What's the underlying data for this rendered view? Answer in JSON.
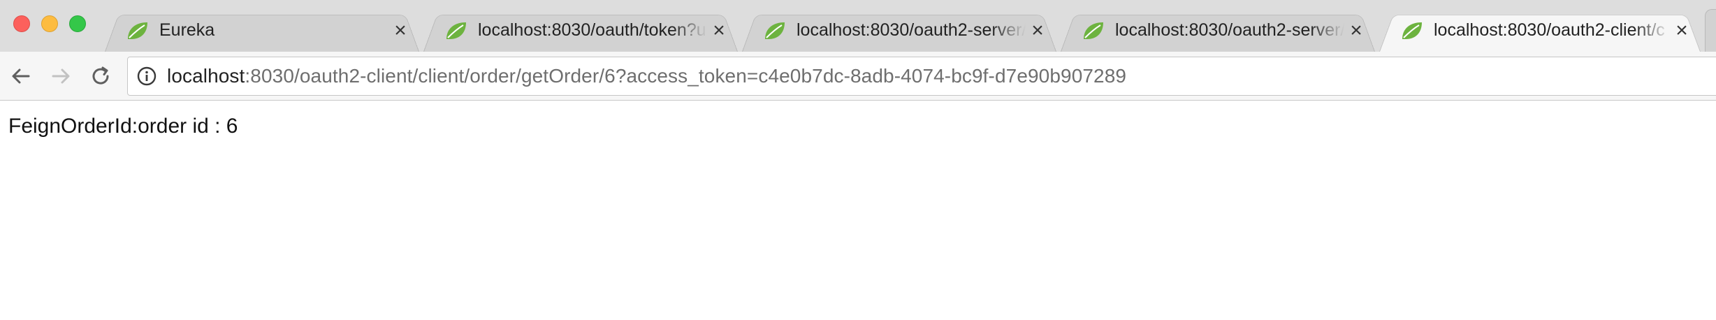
{
  "window": {
    "traffic_lights": [
      "close",
      "minimize",
      "zoom"
    ]
  },
  "tabs": [
    {
      "title": "Eureka",
      "icon": "spring-leaf-icon",
      "close": "×",
      "active": false
    },
    {
      "title": "localhost:8030/oauth/token?us",
      "icon": "spring-leaf-icon",
      "close": "×",
      "active": false
    },
    {
      "title": "localhost:8030/oauth2-server/",
      "icon": "spring-leaf-icon",
      "close": "×",
      "active": false
    },
    {
      "title": "localhost:8030/oauth2-server/",
      "icon": "spring-leaf-icon",
      "close": "×",
      "active": false
    },
    {
      "title": "localhost:8030/oauth2-client/c",
      "icon": "spring-leaf-icon",
      "close": "×",
      "active": true
    }
  ],
  "toolbar": {
    "back_icon": "arrow-left-icon",
    "forward_icon": "arrow-right-icon",
    "reload_icon": "reload-icon",
    "info_icon": "info-icon"
  },
  "address_bar": {
    "host": "localhost",
    "rest": ":8030/oauth2-client/client/order/getOrder/6?access_token=c4e0b7dc-8adb-4074-bc9f-d7e90b907289"
  },
  "page": {
    "text": "FeignOrderId:order id : 6"
  },
  "colors": {
    "tab_strip": "#dddddd",
    "active_tab": "#f6f6f6",
    "leaf_green": "#6db33f",
    "url_host": "#222222",
    "url_rest": "#6e6e6e"
  }
}
